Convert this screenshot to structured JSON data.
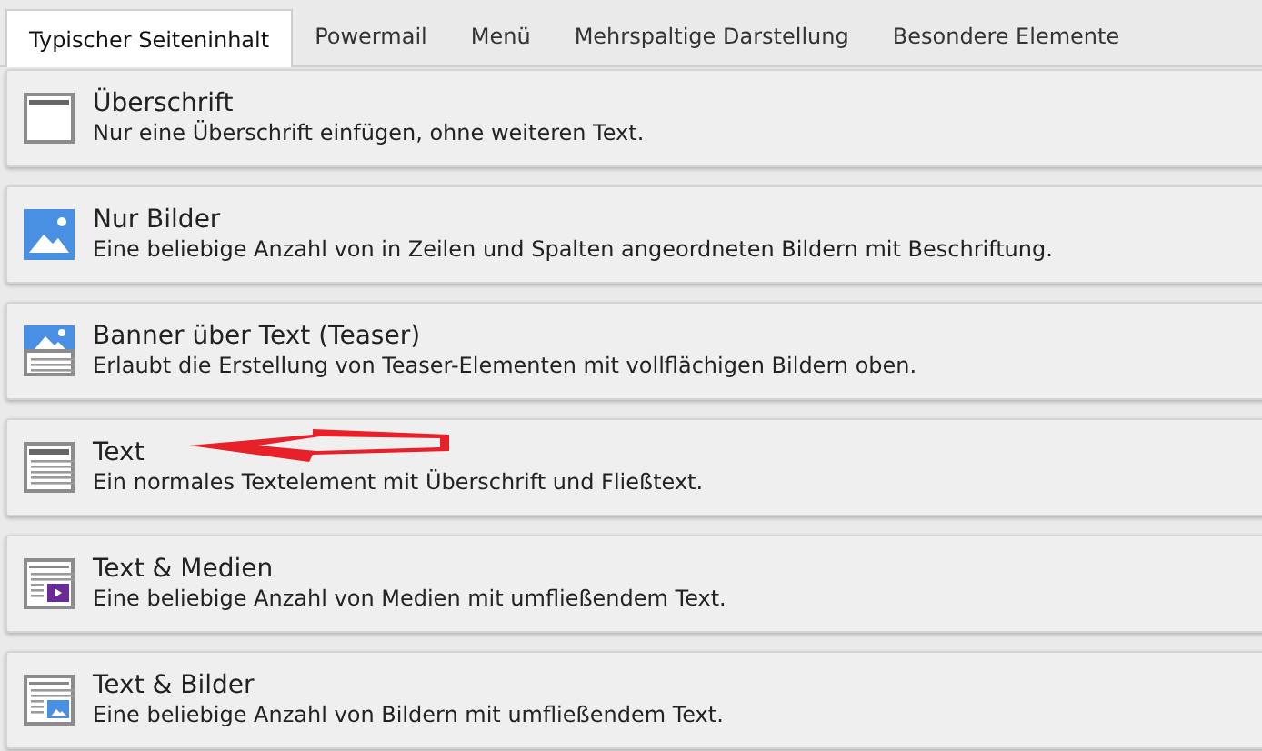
{
  "tabs": [
    {
      "label": "Typischer Seiteninhalt",
      "selected": true
    },
    {
      "label": "Powermail",
      "selected": false
    },
    {
      "label": "Menü",
      "selected": false
    },
    {
      "label": "Mehrspaltige Darstellung",
      "selected": false
    },
    {
      "label": "Besondere Elemente",
      "selected": false
    }
  ],
  "elements": [
    {
      "kind": "header",
      "title": "Überschrift",
      "description": "Nur eine Überschrift einfügen, ohne weiteren Text.",
      "annotated": false
    },
    {
      "kind": "images",
      "title": "Nur Bilder",
      "description": "Eine beliebige Anzahl von in Zeilen und Spalten angeordneten Bildern mit Beschriftung.",
      "annotated": false
    },
    {
      "kind": "banner",
      "title": "Banner über Text (Teaser)",
      "description": "Erlaubt die Erstellung von Teaser-Elementen mit vollflächigen Bildern oben.",
      "annotated": false
    },
    {
      "kind": "text",
      "title": "Text",
      "description": "Ein normales Textelement mit Überschrift und Fließtext.",
      "annotated": true
    },
    {
      "kind": "textmedia",
      "title": "Text & Medien",
      "description": "Eine beliebige Anzahl von Medien mit umfließendem Text.",
      "annotated": false
    },
    {
      "kind": "textpic",
      "title": "Text & Bilder",
      "description": "Eine beliebige Anzahl von Bildern mit umfließendem Text.",
      "annotated": false
    }
  ]
}
